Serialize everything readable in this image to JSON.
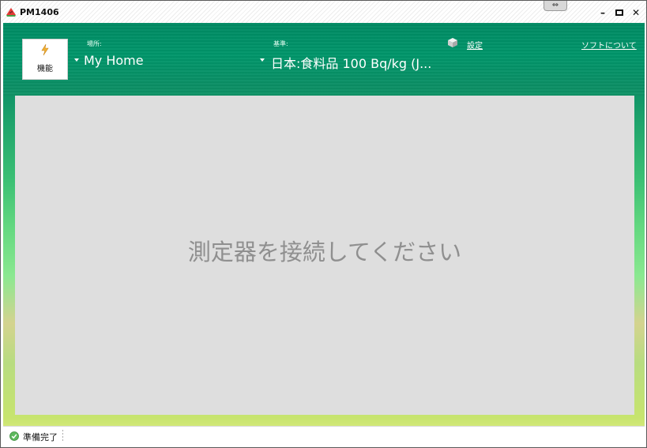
{
  "window": {
    "title": "PM1406",
    "app_icon": "watermelon-icon",
    "grip_glyph": "⇔",
    "minimize_glyph": "–",
    "maximize_glyph": "▫",
    "close_glyph": "✕"
  },
  "header": {
    "function_label": "機能",
    "function_icon": "lightning-icon",
    "location_label": "場所:",
    "location_value": "My Home",
    "standard_label": "基準:",
    "standard_value": "日本:食料品 100 Bq/kg (J...",
    "settings_icon": "box-icon",
    "settings_link": "設定",
    "about_link": "ソフトについて"
  },
  "main": {
    "message": "測定器を接続してください"
  },
  "status": {
    "icon": "check-circle-icon",
    "text": "準備完了"
  },
  "colors": {
    "header_green": "#00966a",
    "content_gray": "#dedede",
    "message_gray": "#8f8f8f",
    "bottom_yellow_green": "#c7e46e"
  }
}
